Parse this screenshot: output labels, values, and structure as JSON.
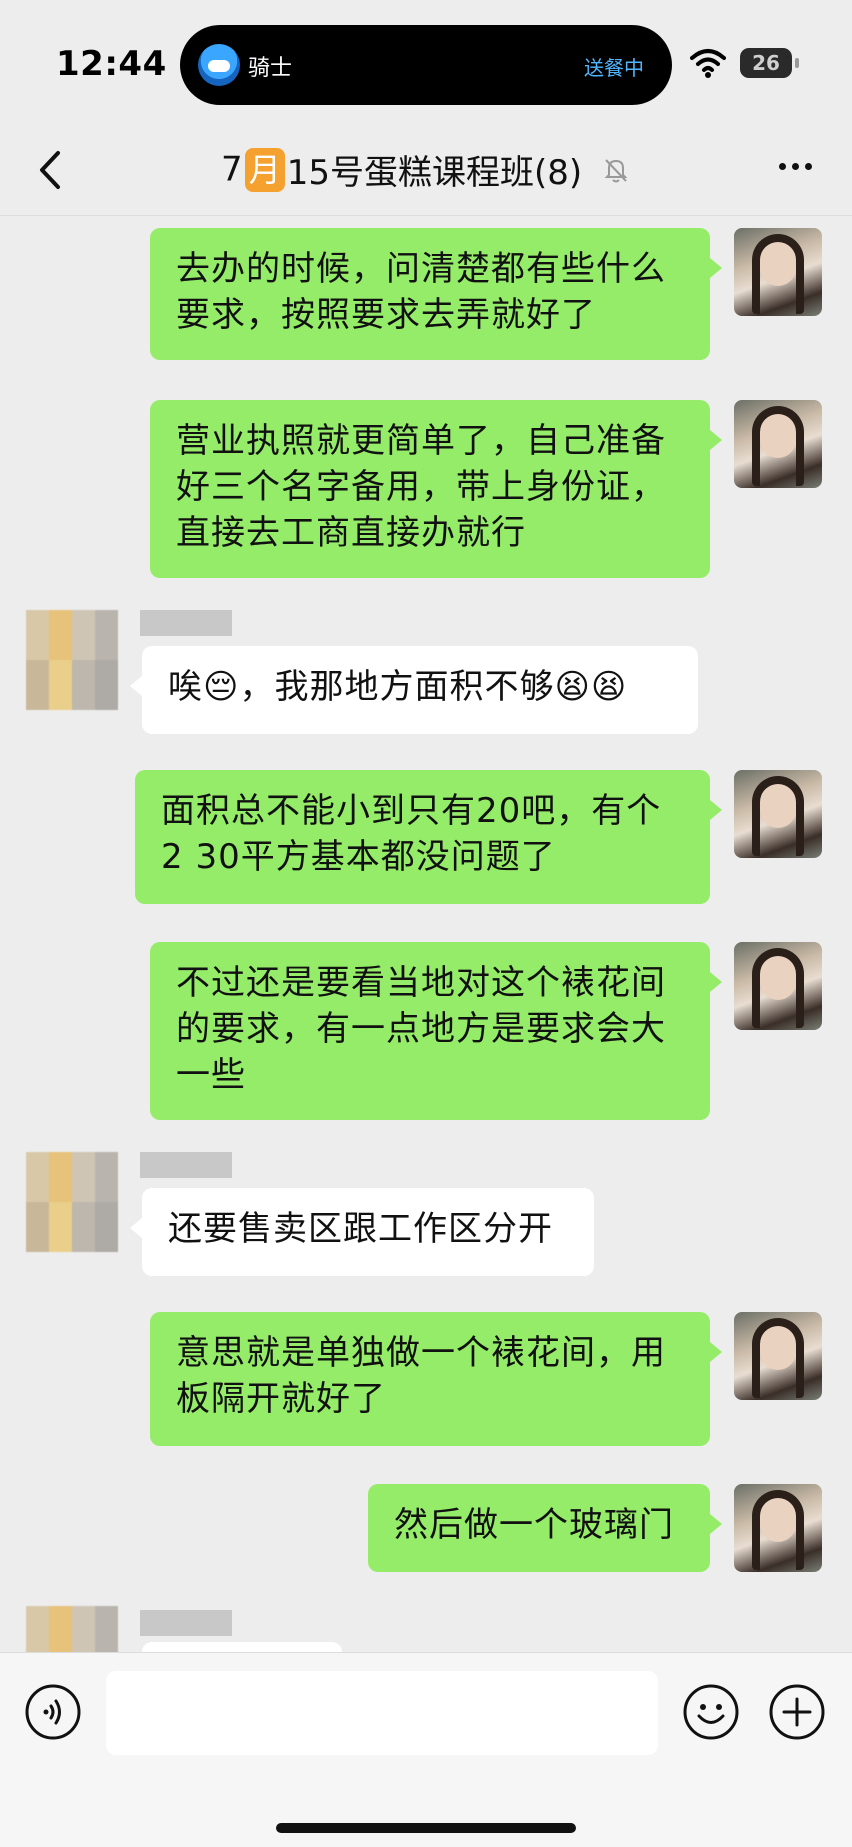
{
  "status_bar": {
    "time": "12:44",
    "island_left": "骑士",
    "island_right": "送餐中",
    "battery": "26"
  },
  "nav": {
    "title_prefix": "7",
    "title_badge": "月",
    "title_suffix": "15号蛋糕课程班(8)"
  },
  "messages": [
    {
      "from": "self",
      "text": "去办的时候，问清楚都有些什么\n要求，按照要求去弄就好了"
    },
    {
      "from": "self",
      "text": "营业执照就更简单了，自己准备\n好三个名字备用，带上身份证，\n直接去工商直接办就行"
    },
    {
      "from": "other",
      "text": "唉😔，我那地方面积不够😫😫"
    },
    {
      "from": "self",
      "text": "面积总不能小到只有20吧，有个\n2 30平方基本都没问题了"
    },
    {
      "from": "self",
      "text": "不过还是要看当地对这个裱花间\n的要求，有一点地方是要求会大\n一些"
    },
    {
      "from": "other",
      "text": "还要售卖区跟工作区分开"
    },
    {
      "from": "self",
      "text": "意思就是单独做一个裱花间，用\n板隔开就好了"
    },
    {
      "from": "self",
      "text": "然后做一个玻璃门"
    }
  ],
  "input": {
    "value": ""
  },
  "icons": {
    "back": "chevron-left-icon",
    "mute": "bell-muted-icon",
    "more": "more-dots-icon",
    "voice": "voice-icon",
    "emoji": "emoji-icon",
    "plus": "plus-icon"
  }
}
